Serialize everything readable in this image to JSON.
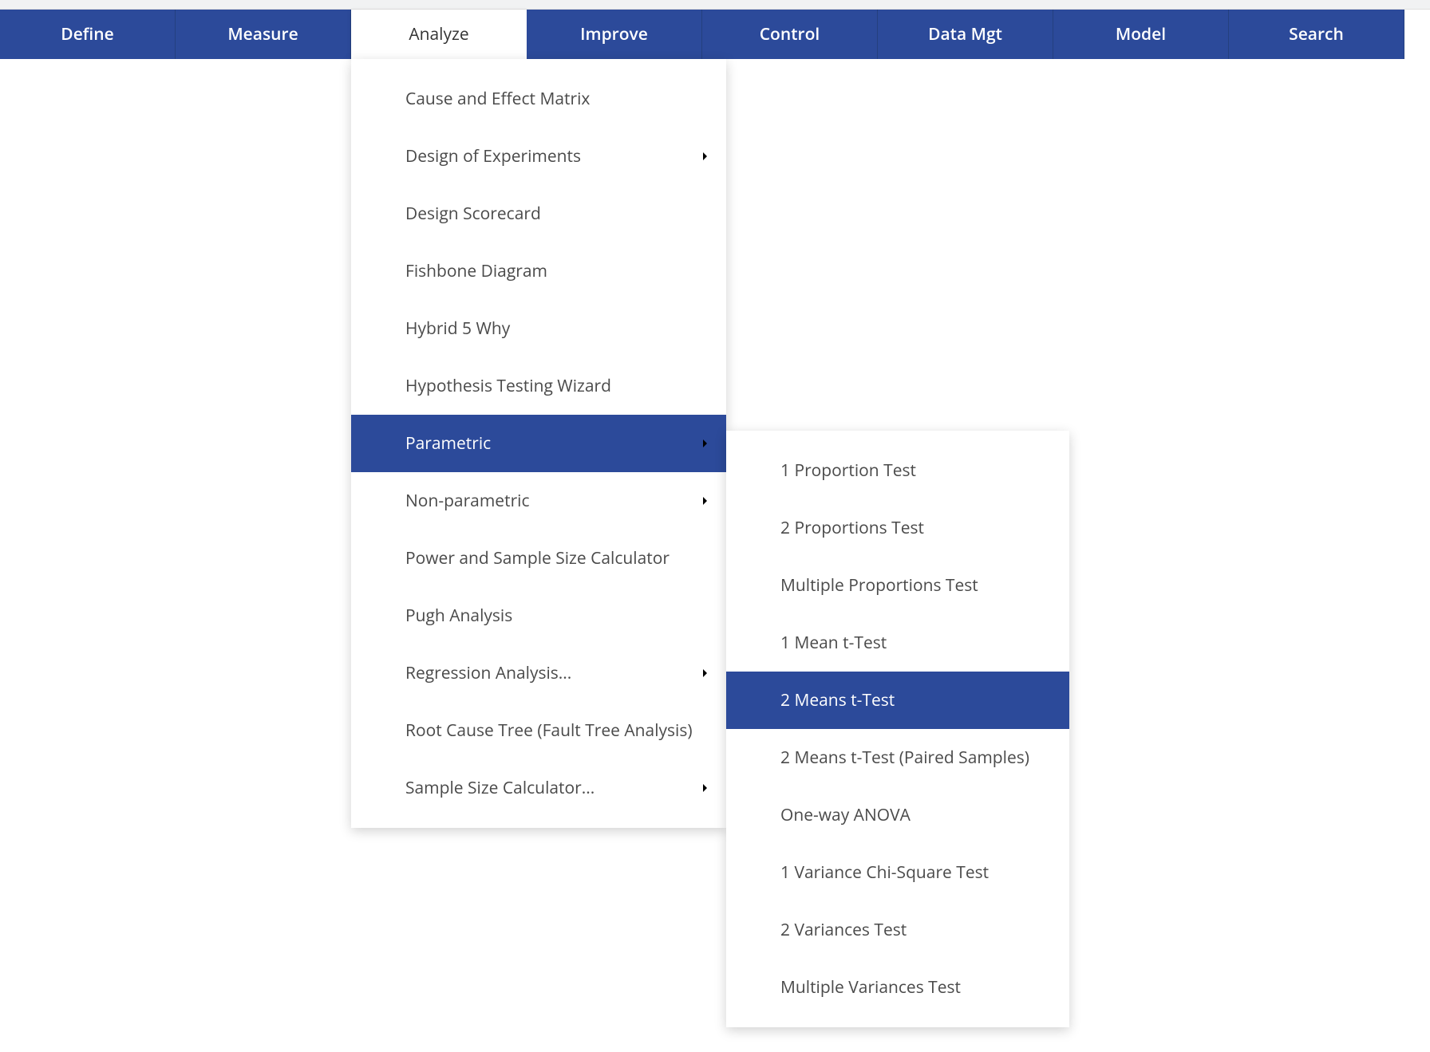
{
  "menubar": {
    "items": [
      {
        "label": "Define",
        "active": false
      },
      {
        "label": "Measure",
        "active": false
      },
      {
        "label": "Analyze",
        "active": true
      },
      {
        "label": "Improve",
        "active": false
      },
      {
        "label": "Control",
        "active": false
      },
      {
        "label": "Data Mgt",
        "active": false
      },
      {
        "label": "Model",
        "active": false
      },
      {
        "label": "Search",
        "active": false
      }
    ]
  },
  "analyze_menu": {
    "items": [
      {
        "label": "Cause and Effect Matrix",
        "icon": "grid",
        "has_submenu": false,
        "highlight": false
      },
      {
        "label": "Design of Experiments",
        "icon": "wrench",
        "has_submenu": true,
        "highlight": false
      },
      {
        "label": "Design Scorecard",
        "icon": "grid",
        "has_submenu": false,
        "highlight": false
      },
      {
        "label": "Fishbone Diagram",
        "icon": "boxes",
        "has_submenu": false,
        "highlight": false
      },
      {
        "label": "Hybrid 5 Why",
        "icon": "grid",
        "has_submenu": false,
        "highlight": false
      },
      {
        "label": "Hypothesis Testing Wizard",
        "icon": "wizard",
        "has_submenu": false,
        "highlight": false
      },
      {
        "label": "Parametric",
        "icon": "wrench",
        "has_submenu": true,
        "highlight": true
      },
      {
        "label": "Non-parametric",
        "icon": "wrench",
        "has_submenu": true,
        "highlight": false
      },
      {
        "label": "Power and Sample Size Calculator",
        "icon": "wrench",
        "has_submenu": false,
        "highlight": false
      },
      {
        "label": "Pugh Analysis",
        "icon": "grid",
        "has_submenu": false,
        "highlight": false
      },
      {
        "label": "Regression Analysis...",
        "icon": "wrench",
        "has_submenu": true,
        "highlight": false
      },
      {
        "label": "Root Cause Tree (Fault Tree Analysis)",
        "icon": "boxes",
        "has_submenu": false,
        "highlight": false
      },
      {
        "label": "Sample Size Calculator...",
        "icon": "wrench",
        "has_submenu": true,
        "highlight": false
      }
    ]
  },
  "parametric_submenu": {
    "items": [
      {
        "label": "1 Proportion Test",
        "icon": "wrench",
        "highlight": false
      },
      {
        "label": "2 Proportions Test",
        "icon": "wrench",
        "highlight": false
      },
      {
        "label": "Multiple Proportions Test",
        "icon": "wrench",
        "highlight": false
      },
      {
        "label": "1 Mean t-Test",
        "icon": "wrench",
        "highlight": false
      },
      {
        "label": "2 Means t-Test",
        "icon": "wrench",
        "highlight": true
      },
      {
        "label": "2 Means t-Test (Paired Samples)",
        "icon": "wrench",
        "highlight": false
      },
      {
        "label": "One-way ANOVA",
        "icon": "wrench",
        "highlight": false
      },
      {
        "label": "1 Variance Chi-Square Test",
        "icon": "wrench",
        "highlight": false
      },
      {
        "label": "2 Variances Test",
        "icon": "wrench",
        "highlight": false
      },
      {
        "label": "Multiple Variances Test",
        "icon": "wrench",
        "highlight": false
      }
    ]
  }
}
